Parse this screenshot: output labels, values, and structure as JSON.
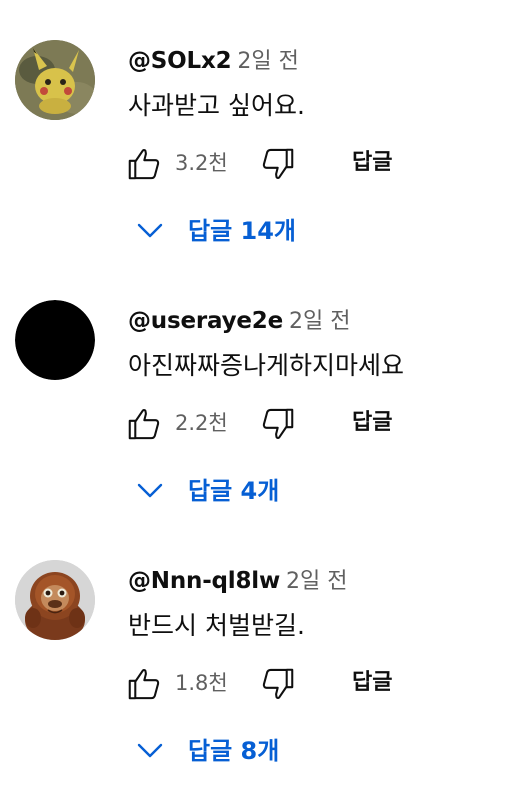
{
  "comments": [
    {
      "avatar": "pikachu-avatar",
      "handle": "@SOLx2",
      "time": "2일 전",
      "text": "사과받고 싶어요.",
      "like_count": "3.2천",
      "reply_label": "답글",
      "replies_label": "답글 14개"
    },
    {
      "avatar": "black-circle-avatar",
      "handle": "@useraye2e",
      "time": "2일 전",
      "text": "아진짜짜증나게하지마세요",
      "like_count": "2.2천",
      "reply_label": "답글",
      "replies_label": "답글 4개"
    },
    {
      "avatar": "orangutan-avatar",
      "handle": "@Nnn-ql8lw",
      "time": "2일 전",
      "text": "반드시 처벌받길.",
      "like_count": "1.8천",
      "reply_label": "답글",
      "replies_label": "답글 8개"
    }
  ],
  "colors": {
    "text_primary": "#0f0f0f",
    "text_secondary": "#606060",
    "link_blue": "#065fd4"
  },
  "icons": {
    "like": "thumbs-up-icon",
    "dislike": "thumbs-down-icon",
    "expand": "chevron-down-icon"
  }
}
